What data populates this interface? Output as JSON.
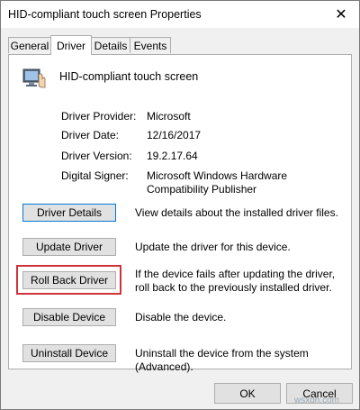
{
  "window": {
    "title": "HID-compliant touch screen Properties",
    "close_glyph": "✕"
  },
  "tabs": [
    {
      "label": "General"
    },
    {
      "label": "Driver",
      "active": true
    },
    {
      "label": "Details"
    },
    {
      "label": "Events"
    }
  ],
  "device": {
    "name": "HID-compliant touch screen",
    "icon": "touch-screen-device-icon"
  },
  "properties": [
    {
      "label": "Driver Provider:",
      "value": "Microsoft"
    },
    {
      "label": "Driver Date:",
      "value": "12/16/2017"
    },
    {
      "label": "Driver Version:",
      "value": "19.2.17.64"
    },
    {
      "label": "Digital Signer:",
      "value": "Microsoft Windows Hardware Compatibility Publisher"
    }
  ],
  "actions": [
    {
      "label": "Driver Details",
      "description": "View details about the installed driver files."
    },
    {
      "label": "Update Driver",
      "description": "Update the driver for this device."
    },
    {
      "label": "Roll Back Driver",
      "description": "If the device fails after updating the driver, roll back to the previously installed driver."
    },
    {
      "label": "Disable Device",
      "description": "Disable the device."
    },
    {
      "label": "Uninstall Device",
      "description": "Uninstall the device from the system (Advanced)."
    }
  ],
  "footer": {
    "ok_label": "OK",
    "cancel_label": "Cancel"
  },
  "watermark": "wsxdn.com",
  "colors": {
    "highlight": "#d0313a",
    "focus": "#0078d7"
  }
}
